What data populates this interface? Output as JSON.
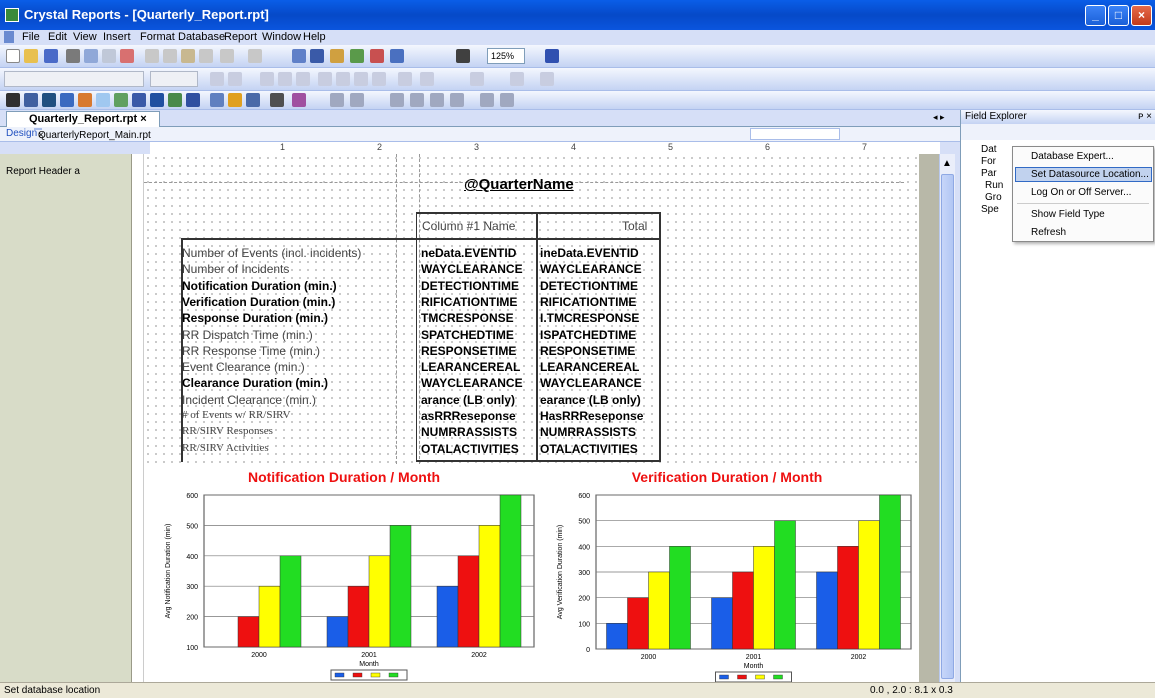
{
  "window": {
    "title": "Crystal Reports - [Quarterly_Report.rpt]"
  },
  "menu": [
    "File",
    "Edit",
    "View",
    "Insert",
    "Format",
    "Database",
    "Report",
    "Window",
    "Help"
  ],
  "toolbar": {
    "zoom": "125%"
  },
  "tabs": {
    "main": "Quarterly_Report.rpt",
    "design": "Design",
    "subreport": "QuarterlyReport_Main.rpt"
  },
  "ruler_marks": [
    "1",
    "2",
    "3",
    "4",
    "5",
    "6",
    "7"
  ],
  "section": {
    "label": "Report Header a"
  },
  "report": {
    "header_field": "@QuarterName",
    "col_header_1": "Column #1 Name",
    "col_header_2": "Total",
    "rows": [
      {
        "label": "Number of Events (incl. incidents)",
        "c1": "neData.EVENTID",
        "c2": "ineData.EVENTID",
        "style": "n"
      },
      {
        "label": "Number of Incidents",
        "c1": "WAYCLEARANCE",
        "c2": "WAYCLEARANCE",
        "style": "n"
      },
      {
        "label": "Notification Duration (min.)",
        "c1": "DETECTIONTIME",
        "c2": "DETECTIONTIME",
        "style": "b"
      },
      {
        "label": "Verification Duration (min.)",
        "c1": "RIFICATIONTIME",
        "c2": "RIFICATIONTIME",
        "style": "b"
      },
      {
        "label": "Response Duration (min.)",
        "c1": "TMCRESPONSE",
        "c2": "I.TMCRESPONSE",
        "style": "b"
      },
      {
        "label": "RR Dispatch Time (min.)",
        "c1": "SPATCHEDTIME",
        "c2": "ISPATCHEDTIME",
        "style": "n"
      },
      {
        "label": "RR Response Time (min.)",
        "c1": "RESPONSETIME",
        "c2": "RESPONSETIME",
        "style": "n"
      },
      {
        "label": "Event Clearance (min.)",
        "c1": "LEARANCEREAL",
        "c2": "LEARANCEREAL",
        "style": "n"
      },
      {
        "label": "Clearance Duration (min.)",
        "c1": "WAYCLEARANCE",
        "c2": "WAYCLEARANCE",
        "style": "b"
      },
      {
        "label": "Incident Clearance (min.)",
        "c1": "arance (LB only)",
        "c2": "earance (LB only)",
        "style": "n"
      },
      {
        "label": "# of Events w/ RR/SIRV",
        "c1": "asRRReseponse",
        "c2": "HasRRReseponse",
        "style": "s"
      },
      {
        "label": "RR/SIRV Responses",
        "c1": "NUMRRASSISTS",
        "c2": "NUMRRASSISTS",
        "style": "s"
      },
      {
        "label": "RR/SIRV Activities",
        "c1": "OTALACTIVITIES",
        "c2": "OTALACTIVITIES",
        "style": "s"
      }
    ]
  },
  "chart_data": [
    {
      "type": "bar",
      "title": "Notification Duration / Month",
      "xlabel": "Month",
      "ylabel": "Avg Notification Duration (min)",
      "ylim": [
        100,
        600
      ],
      "yticks": [
        "100",
        "200",
        "300",
        "400",
        "500",
        "600"
      ],
      "categories": [
        "2000",
        "2001",
        "2002"
      ],
      "series": [
        {
          "color": "#1a5ee8",
          "values": [
            100,
            200,
            300
          ]
        },
        {
          "color": "#ee1010",
          "values": [
            200,
            300,
            400
          ]
        },
        {
          "color": "#ffff00",
          "values": [
            300,
            400,
            500
          ]
        },
        {
          "color": "#22dd22",
          "values": [
            400,
            500,
            600
          ]
        }
      ]
    },
    {
      "type": "bar",
      "title": "Verification Duration / Month",
      "xlabel": "Month",
      "ylabel": "Avg Verification Duration (min)",
      "ylim": [
        0,
        600
      ],
      "yticks": [
        "0",
        "100",
        "200",
        "300",
        "400",
        "500",
        "600"
      ],
      "categories": [
        "2000",
        "2001",
        "2002"
      ],
      "series": [
        {
          "color": "#1a5ee8",
          "values": [
            100,
            200,
            300
          ]
        },
        {
          "color": "#ee1010",
          "values": [
            200,
            300,
            400
          ]
        },
        {
          "color": "#ffff00",
          "values": [
            300,
            400,
            500
          ]
        },
        {
          "color": "#22dd22",
          "values": [
            400,
            500,
            600
          ]
        }
      ]
    }
  ],
  "field_explorer": {
    "title": "Field Explorer",
    "tree": [
      "Dat",
      "For",
      "Par",
      "Run",
      "Gro",
      "Spe"
    ]
  },
  "context_menu": [
    "Database Expert...",
    "Set Datasource Location...",
    "Log On or Off Server...",
    "Show Field Type",
    "Refresh"
  ],
  "status": {
    "text": "Set database location",
    "coords": "0.0 , 2.0 : 8.1 x 0.3"
  }
}
